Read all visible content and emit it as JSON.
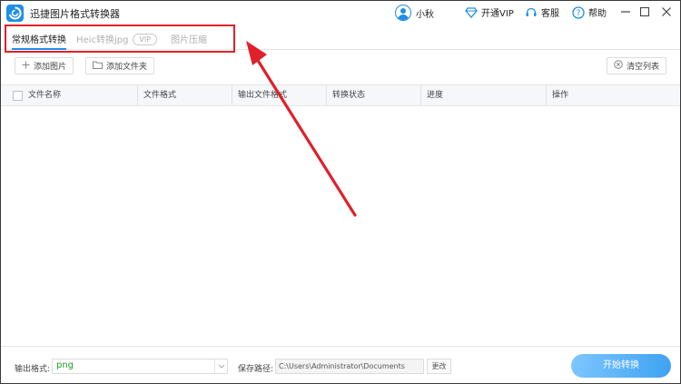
{
  "app": {
    "title": "迅捷图片格式转换器",
    "user_name": "小秋",
    "links": {
      "vip": "开通VIP",
      "service": "客服",
      "help": "帮助"
    }
  },
  "tabs": [
    {
      "label": "常规格式转换",
      "active": true
    },
    {
      "label": "Heic转换jpg",
      "badge": "VIP",
      "active": false
    },
    {
      "label": "图片压缩",
      "active": false
    }
  ],
  "toolbar": {
    "add_image": "添加图片",
    "add_folder": "添加文件夹",
    "clear_list": "清空列表"
  },
  "table": {
    "columns": [
      "文件名称",
      "文件格式",
      "输出文件格式",
      "转换状态",
      "进度",
      "操作"
    ],
    "rows": []
  },
  "bottom": {
    "output_format_label": "输出格式:",
    "output_format_value": "png",
    "save_path_label": "保存路径:",
    "save_path_value": "C:\\Users\\Administrator\\Documents",
    "change_label": "更改",
    "start_label": "开始转换"
  },
  "colors": {
    "accent": "#1e8ee6",
    "annotation": "#e0202a",
    "format_value": "#18a218"
  }
}
